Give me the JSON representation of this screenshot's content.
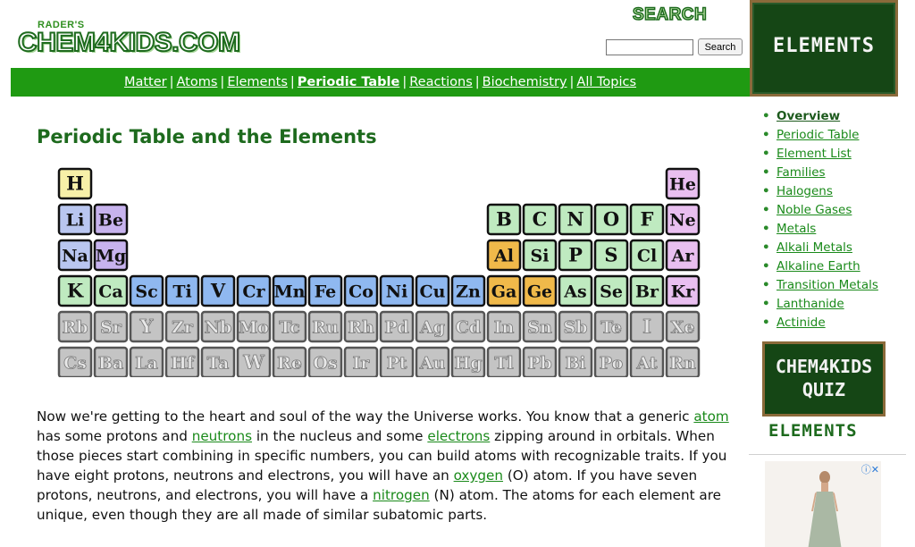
{
  "header": {
    "logo_small": "RADER'S",
    "logo_big": "CHEM4KIDS.COM",
    "search_title": "SEARCH",
    "search_button": "Search",
    "section_board": "ELEMENTS"
  },
  "nav": {
    "items": [
      {
        "label": "Matter",
        "current": false
      },
      {
        "label": "Atoms",
        "current": false
      },
      {
        "label": "Elements",
        "current": false
      },
      {
        "label": "Periodic Table",
        "current": true
      },
      {
        "label": "Reactions",
        "current": false
      },
      {
        "label": "Biochemistry",
        "current": false
      },
      {
        "label": "All Topics",
        "current": false
      }
    ]
  },
  "main": {
    "title": "Periodic Table and the Elements",
    "paragraph": {
      "p1": "Now we're getting to the heart and soul of the way the Universe works. You know that a generic ",
      "link1": "atom",
      "p2": " has some protons and ",
      "link2": "neutrons",
      "p3": " in the nucleus and some ",
      "link3": "electrons",
      "p4": " zipping around in orbitals. When those pieces start combining in specific numbers, you can build atoms with recognizable traits. If you have eight protons, neutrons and electrons, you will have an ",
      "link4": "oxygen",
      "p5": " (O) atom. If you have seven protons, neutrons, and electrons, you will have a ",
      "link5": "nitrogen",
      "p6": " (N) atom. The atoms for each element are unique, even though they are all made of similar subatomic parts."
    }
  },
  "periodic_table": {
    "colors": {
      "hydrogen": "#f7f0a8",
      "alkali": "#b9c6f0",
      "alkaline": "#c7b3ee",
      "transition": "#8fb8f0",
      "post_transition": "#f0b94a",
      "nonmetal": "#bfeac0",
      "noble": "#e9bff0",
      "dimmed": "#c4c4c4"
    },
    "rows": [
      [
        {
          "s": "H",
          "c": 1,
          "t": "hydrogen"
        },
        {
          "s": "He",
          "c": 18,
          "t": "noble"
        }
      ],
      [
        {
          "s": "Li",
          "c": 1,
          "t": "alkali"
        },
        {
          "s": "Be",
          "c": 2,
          "t": "alkaline"
        },
        {
          "s": "B",
          "c": 13,
          "t": "nonmetal"
        },
        {
          "s": "C",
          "c": 14,
          "t": "nonmetal"
        },
        {
          "s": "N",
          "c": 15,
          "t": "nonmetal"
        },
        {
          "s": "O",
          "c": 16,
          "t": "nonmetal"
        },
        {
          "s": "F",
          "c": 17,
          "t": "nonmetal"
        },
        {
          "s": "Ne",
          "c": 18,
          "t": "noble"
        }
      ],
      [
        {
          "s": "Na",
          "c": 1,
          "t": "alkali"
        },
        {
          "s": "Mg",
          "c": 2,
          "t": "alkaline"
        },
        {
          "s": "Al",
          "c": 13,
          "t": "post_transition"
        },
        {
          "s": "Si",
          "c": 14,
          "t": "nonmetal"
        },
        {
          "s": "P",
          "c": 15,
          "t": "nonmetal"
        },
        {
          "s": "S",
          "c": 16,
          "t": "nonmetal"
        },
        {
          "s": "Cl",
          "c": 17,
          "t": "nonmetal"
        },
        {
          "s": "Ar",
          "c": 18,
          "t": "noble"
        }
      ],
      [
        {
          "s": "K",
          "c": 1,
          "t": "nonmetal"
        },
        {
          "s": "Ca",
          "c": 2,
          "t": "nonmetal"
        },
        {
          "s": "Sc",
          "c": 3,
          "t": "transition"
        },
        {
          "s": "Ti",
          "c": 4,
          "t": "transition"
        },
        {
          "s": "V",
          "c": 5,
          "t": "transition"
        },
        {
          "s": "Cr",
          "c": 6,
          "t": "transition"
        },
        {
          "s": "Mn",
          "c": 7,
          "t": "transition"
        },
        {
          "s": "Fe",
          "c": 8,
          "t": "transition"
        },
        {
          "s": "Co",
          "c": 9,
          "t": "transition"
        },
        {
          "s": "Ni",
          "c": 10,
          "t": "transition"
        },
        {
          "s": "Cu",
          "c": 11,
          "t": "transition"
        },
        {
          "s": "Zn",
          "c": 12,
          "t": "transition"
        },
        {
          "s": "Ga",
          "c": 13,
          "t": "post_transition"
        },
        {
          "s": "Ge",
          "c": 14,
          "t": "post_transition"
        },
        {
          "s": "As",
          "c": 15,
          "t": "nonmetal"
        },
        {
          "s": "Se",
          "c": 16,
          "t": "nonmetal"
        },
        {
          "s": "Br",
          "c": 17,
          "t": "nonmetal"
        },
        {
          "s": "Kr",
          "c": 18,
          "t": "noble"
        }
      ],
      [
        {
          "s": "Rb",
          "c": 1,
          "t": "dimmed"
        },
        {
          "s": "Sr",
          "c": 2,
          "t": "dimmed"
        },
        {
          "s": "Y",
          "c": 3,
          "t": "dimmed"
        },
        {
          "s": "Zr",
          "c": 4,
          "t": "dimmed"
        },
        {
          "s": "Nb",
          "c": 5,
          "t": "dimmed"
        },
        {
          "s": "Mo",
          "c": 6,
          "t": "dimmed"
        },
        {
          "s": "Tc",
          "c": 7,
          "t": "dimmed"
        },
        {
          "s": "Ru",
          "c": 8,
          "t": "dimmed"
        },
        {
          "s": "Rh",
          "c": 9,
          "t": "dimmed"
        },
        {
          "s": "Pd",
          "c": 10,
          "t": "dimmed"
        },
        {
          "s": "Ag",
          "c": 11,
          "t": "dimmed"
        },
        {
          "s": "Cd",
          "c": 12,
          "t": "dimmed"
        },
        {
          "s": "In",
          "c": 13,
          "t": "dimmed"
        },
        {
          "s": "Sn",
          "c": 14,
          "t": "dimmed"
        },
        {
          "s": "Sb",
          "c": 15,
          "t": "dimmed"
        },
        {
          "s": "Te",
          "c": 16,
          "t": "dimmed"
        },
        {
          "s": "I",
          "c": 17,
          "t": "dimmed"
        },
        {
          "s": "Xe",
          "c": 18,
          "t": "dimmed"
        }
      ],
      [
        {
          "s": "Cs",
          "c": 1,
          "t": "dimmed"
        },
        {
          "s": "Ba",
          "c": 2,
          "t": "dimmed"
        },
        {
          "s": "La",
          "c": 3,
          "t": "dimmed"
        },
        {
          "s": "Hf",
          "c": 4,
          "t": "dimmed"
        },
        {
          "s": "Ta",
          "c": 5,
          "t": "dimmed"
        },
        {
          "s": "W",
          "c": 6,
          "t": "dimmed"
        },
        {
          "s": "Re",
          "c": 7,
          "t": "dimmed"
        },
        {
          "s": "Os",
          "c": 8,
          "t": "dimmed"
        },
        {
          "s": "Ir",
          "c": 9,
          "t": "dimmed"
        },
        {
          "s": "Pt",
          "c": 10,
          "t": "dimmed"
        },
        {
          "s": "Au",
          "c": 11,
          "t": "dimmed"
        },
        {
          "s": "Hg",
          "c": 12,
          "t": "dimmed"
        },
        {
          "s": "Tl",
          "c": 13,
          "t": "dimmed"
        },
        {
          "s": "Pb",
          "c": 14,
          "t": "dimmed"
        },
        {
          "s": "Bi",
          "c": 15,
          "t": "dimmed"
        },
        {
          "s": "Po",
          "c": 16,
          "t": "dimmed"
        },
        {
          "s": "At",
          "c": 17,
          "t": "dimmed"
        },
        {
          "s": "Rn",
          "c": 18,
          "t": "dimmed"
        }
      ]
    ]
  },
  "sidebar": {
    "items": [
      {
        "label": "Overview",
        "active": true
      },
      {
        "label": "Periodic Table",
        "active": false
      },
      {
        "label": "Element List",
        "active": false
      },
      {
        "label": "Families",
        "active": false
      },
      {
        "label": "Halogens",
        "active": false
      },
      {
        "label": "Noble Gases",
        "active": false
      },
      {
        "label": "Metals",
        "active": false
      },
      {
        "label": "Alkali Metals",
        "active": false
      },
      {
        "label": "Alkaline Earth",
        "active": false
      },
      {
        "label": "Transition Metals",
        "active": false
      },
      {
        "label": "Lanthanide",
        "active": false
      },
      {
        "label": "Actinide",
        "active": false
      }
    ],
    "quiz_line1": "CHEM4KIDS",
    "quiz_line2": "QUIZ",
    "quiz_sub": "ELEMENTS"
  },
  "ad": {
    "icons": "ⓘ✕"
  }
}
